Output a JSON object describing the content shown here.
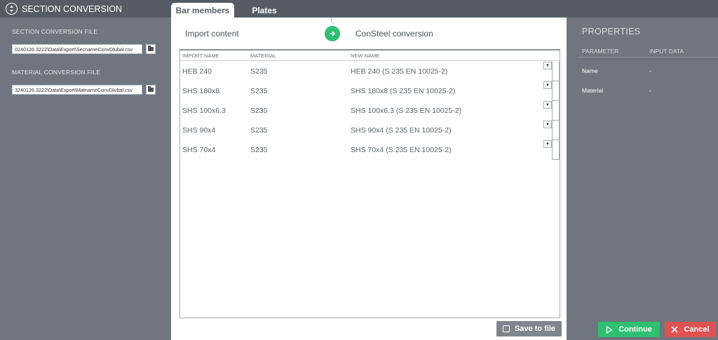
{
  "app": {
    "title": "SECTION CONVERSION"
  },
  "left": {
    "section_label": "SECTION CONVERSION FILE",
    "section_path": "0240126.3222\\Data\\Export\\SecnameConvDlubal.csv",
    "material_label": "MATERIAL CONVERSION FILE",
    "material_path": "3240126.3222\\Data\\Export\\MatnameConvDlubal.csv"
  },
  "tabs": [
    {
      "label": "Bar members",
      "active": true
    },
    {
      "label": "Plates",
      "active": false
    }
  ],
  "center": {
    "import_label": "Import content",
    "conversion_label": "ConSteel conversion",
    "columns": [
      "IMPORT NAME",
      "MATERIAL",
      "NEW NAME"
    ],
    "rows": [
      {
        "import_name": "HEB 240",
        "material": "S235",
        "new_name": "HEB 240 (S 235 EN 10025-2)"
      },
      {
        "import_name": "SHS 180x8",
        "material": "S235",
        "new_name": "SHS 180x8 (S 235 EN 10025-2)"
      },
      {
        "import_name": "SHS 100x6.3",
        "material": "S235",
        "new_name": "SHS 100x6.3 (S 235 EN 10025-2)"
      },
      {
        "import_name": "SHS 90x4",
        "material": "S235",
        "new_name": "SHS 90x4 (S 235 EN 10025-2)"
      },
      {
        "import_name": "SHS 70x4",
        "material": "S235",
        "new_name": "SHS 70x4 (S 235 EN 10025-2)"
      }
    ],
    "dropdown_glyph": "▼",
    "save_label": "Save to file"
  },
  "properties": {
    "title": "PROPERTIES",
    "col_parameter": "PARAMETER",
    "col_input": "INPUT DATA",
    "items": [
      {
        "name": "Name",
        "value": "-"
      },
      {
        "name": "Material",
        "value": "-"
      }
    ]
  },
  "actions": {
    "continue_label": "Continue",
    "cancel_label": "Cancel"
  },
  "colors": {
    "accent_green": "#2fbf71",
    "cancel_red": "#e05252",
    "panel_gray": "#6f7680",
    "topbar_gray": "#555c66"
  }
}
